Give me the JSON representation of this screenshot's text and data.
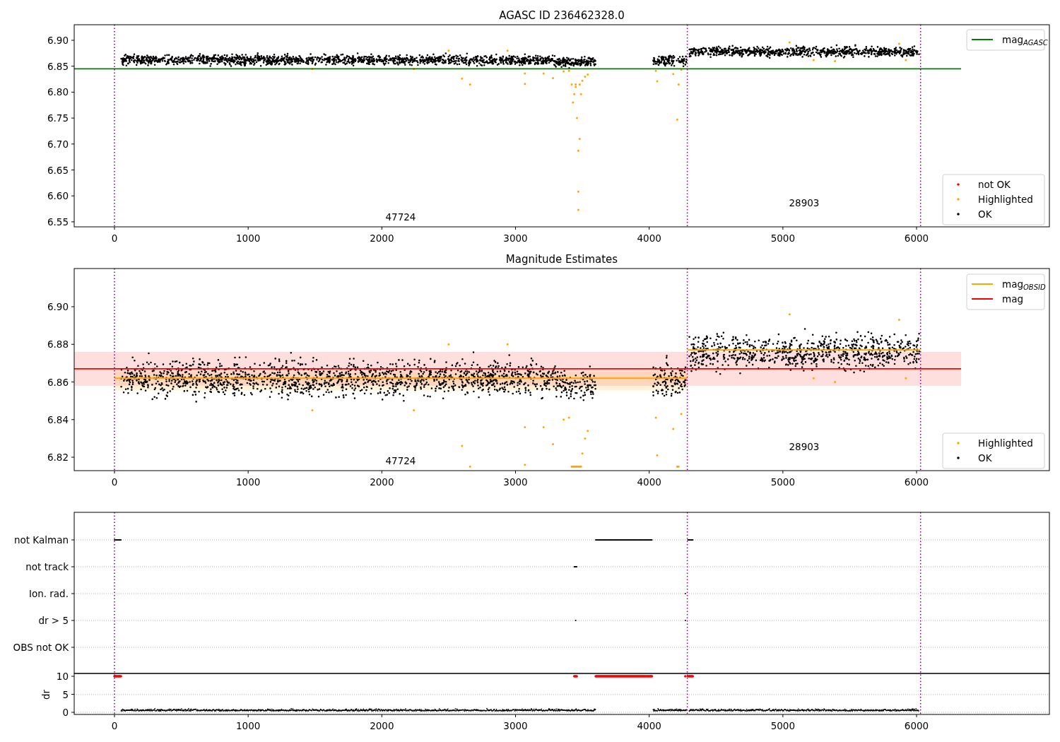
{
  "panels": [
    {
      "title": "AGASC ID 236462328.0",
      "yticks": [
        "6.90",
        "6.85",
        "6.80",
        "6.75",
        "6.70",
        "6.65",
        "6.60",
        "6.55"
      ],
      "xticks": [
        "0",
        "1000",
        "2000",
        "3000",
        "4000",
        "5000",
        "6000"
      ],
      "legends": [
        [
          {
            "kind": "line",
            "label": "mag",
            "subscript": "AGASC",
            "color": "#008000"
          }
        ],
        [
          {
            "kind": "dot",
            "label": "not OK",
            "color": "#ff0000"
          },
          {
            "kind": "dot",
            "label": "Highlighted",
            "color": "#ffa500"
          },
          {
            "kind": "dot",
            "label": "OK",
            "color": "#000000"
          }
        ]
      ],
      "annotations": [
        "47724",
        "28903"
      ]
    },
    {
      "title": "Magnitude Estimates",
      "yticks": [
        "6.90",
        "6.88",
        "6.86",
        "6.84",
        "6.82"
      ],
      "xticks": [
        "0",
        "1000",
        "2000",
        "3000",
        "4000",
        "5000",
        "6000"
      ],
      "legends": [
        [
          {
            "kind": "line",
            "label": "mag",
            "subscript": "OBSID",
            "color": "#ffa500"
          },
          {
            "kind": "line",
            "label": "mag",
            "color": "#ff0000"
          }
        ],
        [
          {
            "kind": "dot",
            "label": "Highlighted",
            "color": "#ffa500"
          },
          {
            "kind": "dot",
            "label": "OK",
            "color": "#000000"
          }
        ]
      ],
      "annotations": [
        "47724",
        "28903"
      ]
    },
    {
      "categories": [
        "not Kalman",
        "not track",
        "Ion. rad.",
        "dr > 5",
        "OBS not OK"
      ],
      "ylabel": "dr",
      "dr_ticks": [
        "10",
        "5",
        "0"
      ],
      "xticks": [
        "0",
        "1000",
        "2000",
        "3000",
        "4000",
        "5000",
        "6000"
      ]
    }
  ]
}
